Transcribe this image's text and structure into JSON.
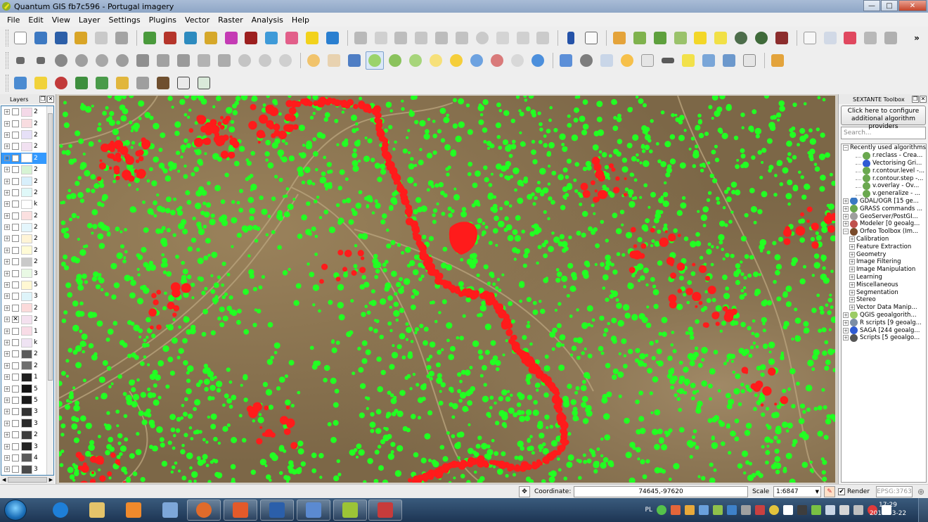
{
  "window": {
    "title": "Quantum GIS fb7c596 - Portugal imagery",
    "min": "—",
    "max": "□",
    "close": "✕"
  },
  "menu": [
    "File",
    "Edit",
    "View",
    "Layer",
    "Settings",
    "Plugins",
    "Vector",
    "Raster",
    "Analysis",
    "Help"
  ],
  "toolbar_more": "»",
  "layers_panel": {
    "title": "Layers",
    "items": [
      {
        "label": "2",
        "checked": false,
        "selected": false,
        "swatch": "#f4d9e8"
      },
      {
        "label": "2",
        "checked": false,
        "selected": false,
        "swatch": "#f8dce0"
      },
      {
        "label": "2",
        "checked": false,
        "selected": false,
        "swatch": "#e6e0f7"
      },
      {
        "label": "2",
        "checked": false,
        "selected": false,
        "swatch": "#f1e1f1"
      },
      {
        "label": "2",
        "checked": true,
        "selected": true,
        "swatch": "#ffffff"
      },
      {
        "label": "2",
        "checked": false,
        "selected": false,
        "swatch": "#d7f3d4"
      },
      {
        "label": "2",
        "checked": false,
        "selected": false,
        "swatch": "#d8effb"
      },
      {
        "label": "2",
        "checked": false,
        "selected": false,
        "swatch": "#dff8f8"
      },
      {
        "label": "k",
        "checked": false,
        "selected": false,
        "swatch": "#ffffff"
      },
      {
        "label": "2",
        "checked": false,
        "selected": false,
        "swatch": "#fbe0e0"
      },
      {
        "label": "2",
        "checked": false,
        "selected": false,
        "swatch": "#e4f6fc"
      },
      {
        "label": "2",
        "checked": false,
        "selected": false,
        "swatch": "#fff4d6"
      },
      {
        "label": "2",
        "checked": false,
        "selected": false,
        "swatch": "#fffbd6"
      },
      {
        "label": "2",
        "checked": false,
        "selected": false,
        "swatch": "#c9c9c9"
      },
      {
        "label": "3",
        "checked": false,
        "selected": false,
        "swatch": "#e9f9e4"
      },
      {
        "label": "5",
        "checked": false,
        "selected": false,
        "swatch": "#fff8d3"
      },
      {
        "label": "3",
        "checked": false,
        "selected": false,
        "swatch": "#def4fa"
      },
      {
        "label": "2",
        "checked": false,
        "selected": false,
        "swatch": "#fbdada"
      },
      {
        "label": "2",
        "checked": true,
        "selected": false,
        "swatch": "#f4e1ef"
      },
      {
        "label": "1",
        "checked": false,
        "selected": false,
        "swatch": "#f8dce6"
      },
      {
        "label": "k",
        "checked": false,
        "selected": false,
        "swatch": "#efe3f3"
      },
      {
        "label": "2",
        "checked": false,
        "selected": false,
        "swatch": "#5b5b5b"
      },
      {
        "label": "2",
        "checked": false,
        "selected": false,
        "swatch": "#6e6e6e"
      },
      {
        "label": "1",
        "checked": false,
        "selected": false,
        "swatch": "#202020"
      },
      {
        "label": "5",
        "checked": false,
        "selected": false,
        "swatch": "#151515"
      },
      {
        "label": "5",
        "checked": false,
        "selected": false,
        "swatch": "#1b1b1b"
      },
      {
        "label": "3",
        "checked": false,
        "selected": false,
        "swatch": "#333333"
      },
      {
        "label": "3",
        "checked": false,
        "selected": false,
        "swatch": "#2b2b2b"
      },
      {
        "label": "2",
        "checked": false,
        "selected": false,
        "swatch": "#3d3d3d"
      },
      {
        "label": "3",
        "checked": false,
        "selected": false,
        "swatch": "#242424"
      },
      {
        "label": "4",
        "checked": false,
        "selected": false,
        "swatch": "#5a5a5a"
      },
      {
        "label": "3",
        "checked": false,
        "selected": false,
        "swatch": "#4a4a4a"
      }
    ]
  },
  "sextante": {
    "title": "SEXTANTE Toolbox",
    "config_line1": "Click here to configure",
    "config_line2": "additional algorithm providers",
    "search_placeholder": "Search...",
    "tree": [
      {
        "label": "Recently used algorithms",
        "level": 0,
        "exp": "⊟",
        "icon": ""
      },
      {
        "label": "r.reclass - Crea...",
        "level": 2,
        "exp": "",
        "icon": "#6aa84f"
      },
      {
        "label": "Vectorising Gri...",
        "level": 2,
        "exp": "",
        "icon": "#2f5bd3"
      },
      {
        "label": "r.contour.level -...",
        "level": 2,
        "exp": "",
        "icon": "#6aa84f"
      },
      {
        "label": "r.contour.step -...",
        "level": 2,
        "exp": "",
        "icon": "#6aa84f"
      },
      {
        "label": "v.overlay - Ov...",
        "level": 2,
        "exp": "",
        "icon": "#6aa84f"
      },
      {
        "label": "v.generalize - ...",
        "level": 2,
        "exp": "",
        "icon": "#6aa84f"
      },
      {
        "label": "GDAL/OGR [15 ge...",
        "level": 0,
        "exp": "⊞",
        "icon": "#3a78c3"
      },
      {
        "label": "GRASS commands ...",
        "level": 0,
        "exp": "⊞",
        "icon": "#6aa84f"
      },
      {
        "label": "GeoServer/PostGI...",
        "level": 0,
        "exp": "⊞",
        "icon": "#9e9e9e"
      },
      {
        "label": "Modeler [0 geoalg...",
        "level": 0,
        "exp": "⊞",
        "icon": "#c0504d"
      },
      {
        "label": "Orfeo Toolbox (Im...",
        "level": 0,
        "exp": "⊟",
        "icon": "#7a4b2a"
      },
      {
        "label": "Calibration",
        "level": 1,
        "exp": "⊞",
        "icon": ""
      },
      {
        "label": "Feature Extraction",
        "level": 1,
        "exp": "⊞",
        "icon": ""
      },
      {
        "label": "Geometry",
        "level": 1,
        "exp": "⊞",
        "icon": ""
      },
      {
        "label": "Image Filtering",
        "level": 1,
        "exp": "⊞",
        "icon": ""
      },
      {
        "label": "Image Manipulation",
        "level": 1,
        "exp": "⊞",
        "icon": ""
      },
      {
        "label": "Learning",
        "level": 1,
        "exp": "⊞",
        "icon": ""
      },
      {
        "label": "Miscellaneous",
        "level": 1,
        "exp": "⊞",
        "icon": ""
      },
      {
        "label": "Segmentation",
        "level": 1,
        "exp": "⊞",
        "icon": ""
      },
      {
        "label": "Stereo",
        "level": 1,
        "exp": "⊞",
        "icon": ""
      },
      {
        "label": "Vector Data Manip...",
        "level": 1,
        "exp": "⊞",
        "icon": ""
      },
      {
        "label": "QGIS geoalgorith...",
        "level": 0,
        "exp": "⊞",
        "icon": "#9ccc65"
      },
      {
        "label": "R scripts [9 geoalg...",
        "level": 0,
        "exp": "⊞",
        "icon": "#7c8ea6"
      },
      {
        "label": "SAGA [244 geoalg...",
        "level": 0,
        "exp": "⊞",
        "icon": "#2f5bd3"
      },
      {
        "label": "Scripts [5 geoalgo...",
        "level": 0,
        "exp": "⊞",
        "icon": "#555555"
      }
    ]
  },
  "statusbar": {
    "coordinate_label": "Coordinate:",
    "coordinate_value": "74645,-97620",
    "scale_label": "Scale",
    "scale_value": "1:6847",
    "render_label": "Render",
    "crs": "EPSG:3763"
  },
  "taskbar": {
    "lang": "PL",
    "time": "17:29",
    "date": "2013-03-22"
  },
  "colors": {
    "accent": "#3399ff",
    "vegetation": "#22ff22",
    "change": "#ff1b1b",
    "terrain": "#8a7451"
  }
}
